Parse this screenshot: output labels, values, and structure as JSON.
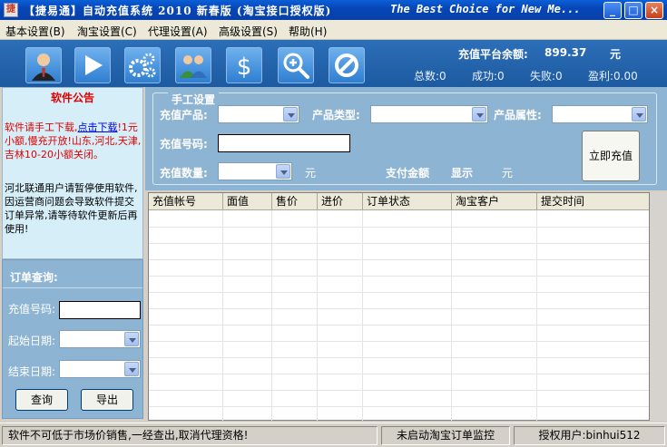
{
  "window": {
    "title": "【捷易通】自动充值系统 2010 新春版 (淘宝接口授权版)",
    "slogan": "The Best Choice for New Me...",
    "minimize": "_",
    "maximize": "□",
    "close": "×"
  },
  "menu": [
    {
      "label": "基本设置(B)"
    },
    {
      "label": "淘宝设置(C)"
    },
    {
      "label": "代理设置(A)"
    },
    {
      "label": "高级设置(S)"
    },
    {
      "label": "帮助(H)"
    }
  ],
  "toolbar": {
    "icons": [
      "user-icon",
      "play-icon",
      "gears-icon",
      "users-icon",
      "dollar-icon",
      "zoom-icon",
      "forbidden-icon"
    ],
    "balance_label": "充值平台余额:",
    "balance_value": "899.37",
    "balance_unit": "元",
    "stats": {
      "total": "总数:0",
      "success": "成功:0",
      "fail": "失败:0",
      "profit": "盈利:0.00"
    }
  },
  "notice": {
    "title": "软件公告",
    "msg_part1": "软件请手工下载,",
    "msg_link": "点击下载",
    "msg_part2": "!1元小额,慢充开放!山东,河北,天津,吉林10-20小额关闭。",
    "msg_second": "河北联通用户请暂停使用软件,因运营商问题会导致软件提交订单异常,请等待软件更新后再使用!"
  },
  "order_query": {
    "title": "订单查询:",
    "number_label": "充值号码:",
    "start_label": "起始日期:",
    "end_label": "结束日期:",
    "query_button": "查询",
    "export_button": "导出"
  },
  "manual": {
    "legend": "手工设置",
    "product_label": "充值产品:",
    "type_label": "产品类型:",
    "attr_label": "产品属性:",
    "number_label": "充值号码:",
    "qty_label": "充值数量:",
    "qty_unit": "元",
    "pay_label": "支付金额",
    "pay_value": "显示",
    "pay_unit": "元",
    "recharge_button": "立即充值"
  },
  "grid": {
    "columns": [
      "充值帐号",
      "面值",
      "售价",
      "进价",
      "订单状态",
      "淘宝客户",
      "提交时间"
    ]
  },
  "status": {
    "warning": "软件不可低于市场价销售,一经查出,取消代理资格!",
    "taobao": "未启动淘宝订单监控",
    "user": "授权用户:binhui512"
  }
}
